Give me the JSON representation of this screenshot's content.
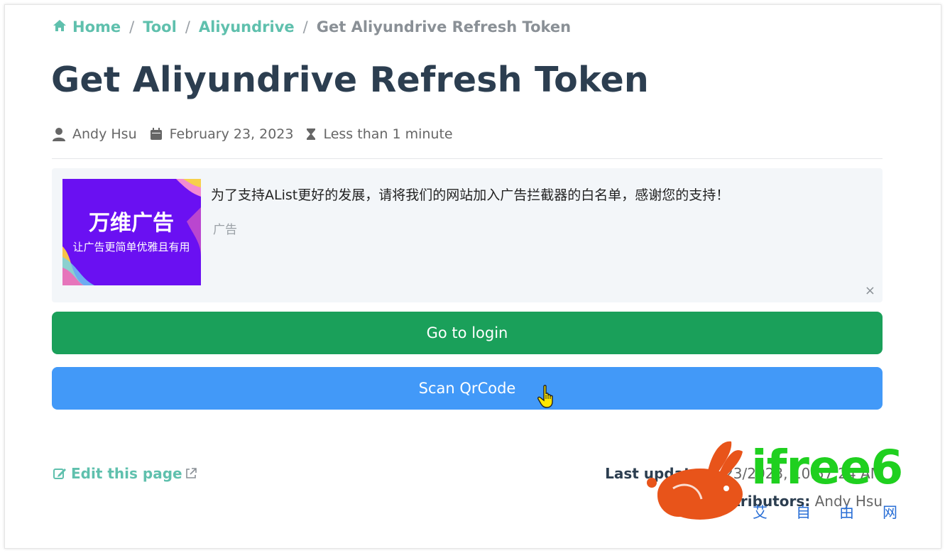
{
  "breadcrumb": {
    "items": [
      {
        "label": "Home"
      },
      {
        "label": "Tool"
      },
      {
        "label": "Aliyundrive"
      }
    ],
    "separator": "/",
    "current": "Get Aliyundrive Refresh Token"
  },
  "page": {
    "title": "Get Aliyundrive Refresh Token"
  },
  "meta": {
    "author": "Andy Hsu",
    "date": "February 23, 2023",
    "reading_time": "Less than 1 minute"
  },
  "ad": {
    "image_title": "万维广告",
    "image_subtitle": "让广告更简单优雅且有用",
    "text": "为了支持AList更好的发展，请将我们的网站加入广告拦截器的白名单，感谢您的支持！",
    "tag": "广告",
    "close": "×"
  },
  "buttons": {
    "login": "Go to login",
    "scan": "Scan QrCode"
  },
  "footer": {
    "edit_label": "Edit this page",
    "last_updated_label": "Last update:",
    "last_updated_value": "2/23/2023, 10:57:24 AM",
    "contributors_label": "Contributors:",
    "contributors_value": "Andy Hsu"
  },
  "watermark": {
    "brand": "ifree6",
    "sub": "艾自由网"
  },
  "colors": {
    "accent": "#5fc0ad",
    "login_button": "#1aa05a",
    "scan_button": "#4299f8",
    "title": "#2c3e50"
  }
}
